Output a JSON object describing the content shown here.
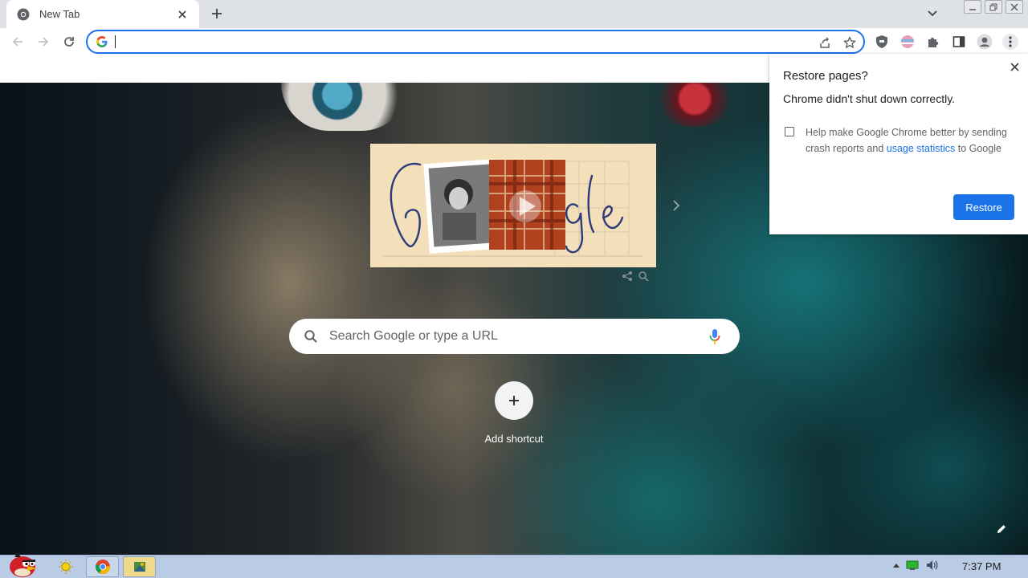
{
  "browser": {
    "tab": {
      "title": "New Tab"
    },
    "omnibox": {
      "value": "",
      "placeholder": ""
    }
  },
  "new_tab_page": {
    "search": {
      "placeholder": "Search Google or type a URL"
    },
    "shortcut": {
      "label": "Add shortcut"
    }
  },
  "restore_bubble": {
    "title": "Restore pages?",
    "message": "Chrome didn't shut down correctly.",
    "checkbox_text": "Help make Google Chrome better by sending crash reports and",
    "checkbox_link": "usage statistics",
    "checkbox_suffix": "to Google",
    "checkbox_checked": false,
    "button_label": "Restore"
  },
  "taskbar": {
    "clock": "7:37 PM"
  },
  "colors": {
    "accent": "#1a73e8",
    "tabstrip": "#dee1e6",
    "taskbar": "#b9cbe5"
  }
}
